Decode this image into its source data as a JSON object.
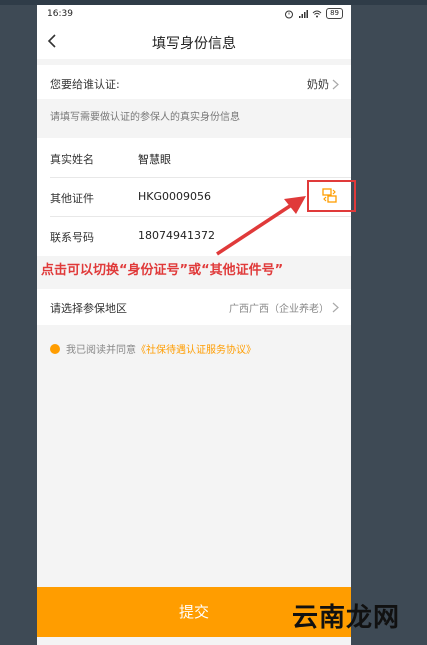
{
  "statusbar": {
    "time": "16:39",
    "battery": "89"
  },
  "nav": {
    "title": "填写身份信息"
  },
  "certify_for": {
    "label": "您要给谁认证:",
    "value": "奶奶"
  },
  "hint_text": "请填写需要做认证的参保人的真实身份信息",
  "form": {
    "name": {
      "label": "真实姓名",
      "value": "智慧眼"
    },
    "other_id": {
      "label": "其他证件",
      "value": "HKG0009056"
    },
    "phone": {
      "label": "联系号码",
      "value": "18074941372"
    }
  },
  "annotation": "点击可以切换“身份证号”或“其他证件号”",
  "region": {
    "label": "请选择参保地区",
    "value": "广西广西（企业养老）"
  },
  "agreement": {
    "prefix": "我已阅读并同意",
    "link": "《社保待遇认证服务协议》"
  },
  "submit_label": "提交",
  "watermark": "云南龙网",
  "colors": {
    "accent": "#ff9d00",
    "annotation": "#e03a3a",
    "background": "#f4f4f4"
  },
  "icons": [
    "back-arrow-icon",
    "chevron-right-icon",
    "id-switch-icon",
    "alarm-icon",
    "wifi-icon",
    "signal-icon",
    "battery-icon"
  ]
}
